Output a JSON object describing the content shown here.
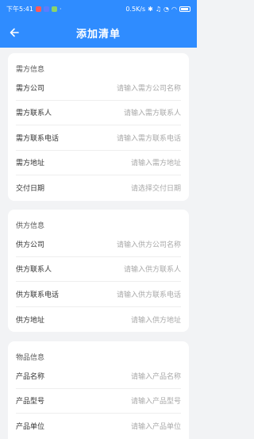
{
  "status_bar": {
    "time": "下午5:41",
    "speed": "0.5K/s"
  },
  "header": {
    "title": "添加清单",
    "back_icon": "arrow-left-icon"
  },
  "colors": {
    "primary": "#2f8cff",
    "background": "#f2f3f5",
    "placeholder": "#a8a8a8"
  },
  "demander": {
    "section_title": "需方信息",
    "rows": [
      {
        "label": "需方公司",
        "placeholder": "请输入需方公司名称"
      },
      {
        "label": "需方联系人",
        "placeholder": "请输入需方联系人"
      },
      {
        "label": "需方联系电话",
        "placeholder": "请输入需方联系电话"
      },
      {
        "label": "需方地址",
        "placeholder": "请输入需方地址"
      },
      {
        "label": "交付日期",
        "placeholder": "请选择交付日期"
      }
    ]
  },
  "supplier": {
    "section_title": "供方信息",
    "rows": [
      {
        "label": "供方公司",
        "placeholder": "请输入供方公司名称"
      },
      {
        "label": "供方联系人",
        "placeholder": "请输入供方联系人"
      },
      {
        "label": "供方联系电话",
        "placeholder": "请输入供方联系电话"
      },
      {
        "label": "供方地址",
        "placeholder": "请输入供方地址"
      }
    ]
  },
  "goods": {
    "section_title": "物品信息",
    "rows": [
      {
        "label": "产品名称",
        "placeholder": "请输入产品名称"
      },
      {
        "label": "产品型号",
        "placeholder": "请输入产品型号"
      },
      {
        "label": "产品单位",
        "placeholder": "请输入产品单位"
      }
    ]
  }
}
